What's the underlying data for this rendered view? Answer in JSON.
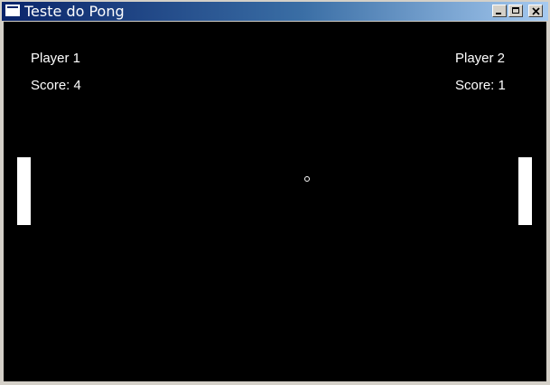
{
  "window": {
    "title": "Teste do Pong",
    "icon": "window-app-icon",
    "controls": [
      "minimize-icon",
      "maximize-icon",
      "close-icon"
    ]
  },
  "game": {
    "player1": {
      "name": "Player 1",
      "score_label": "Score: 4",
      "score": 4
    },
    "player2": {
      "name": "Player 2",
      "score_label": "Score: 1",
      "score": 1
    }
  },
  "colors": {
    "background": "#000000",
    "foreground": "#ffffff",
    "titlebar_start": "#0a246a",
    "titlebar_end": "#a6caf0"
  }
}
